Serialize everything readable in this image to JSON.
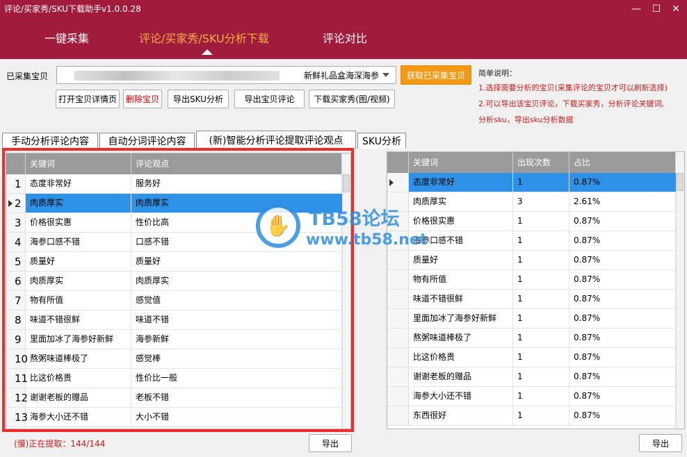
{
  "window": {
    "title": "评论/买家秀/SKU下载助手v1.0.0.28",
    "controls": [
      "—",
      "☐",
      "✕"
    ]
  },
  "nav": [
    {
      "label": "一键采集"
    },
    {
      "label": "评论/买家秀/SKU分析下载"
    },
    {
      "label": "评论对比"
    }
  ],
  "toolbar": {
    "collected_label": "已采集宝贝",
    "combo_value": "新鲜礼品盒海深海参",
    "fetch_button": "获取已采集宝贝",
    "buttons": [
      "打开宝贝详情页",
      "删除宝贝",
      "导出SKU分析",
      "导出宝贝评论",
      "下载买家秀(图/视频)"
    ]
  },
  "description": {
    "title": "简单说明：",
    "lines": [
      "1.选择需要分析的宝贝(采集评论的宝贝才可以刷新选择)",
      "2.可以导出该宝贝评论，下载买家秀，分析评论关键词,",
      "分析sku，导出sku分析数据"
    ]
  },
  "tabs": [
    "手动分析评论内容",
    "自动分词评论内容",
    "(新)智能分析评论提取评论观点",
    "SKU分析"
  ],
  "left_grid": {
    "headers": [
      "关键词",
      "评论观点"
    ],
    "rows": [
      {
        "num": "1",
        "keyword": "态度非常好",
        "opinion": "服务好"
      },
      {
        "num": "2",
        "keyword": "肉质厚实",
        "opinion": "肉质厚实"
      },
      {
        "num": "3",
        "keyword": "价格很实惠",
        "opinion": "性价比高"
      },
      {
        "num": "4",
        "keyword": "海参口感不错",
        "opinion": "口感不错"
      },
      {
        "num": "5",
        "keyword": "质量好",
        "opinion": "质量好"
      },
      {
        "num": "6",
        "keyword": "肉质厚实",
        "opinion": "肉质厚实"
      },
      {
        "num": "7",
        "keyword": "物有所值",
        "opinion": "感觉值"
      },
      {
        "num": "8",
        "keyword": "味道不错很鲜",
        "opinion": "味道不错"
      },
      {
        "num": "9",
        "keyword": "里面加冰了海参好新鲜",
        "opinion": "海参新鲜"
      },
      {
        "num": "10",
        "keyword": "熬粥味道棒极了",
        "opinion": "感觉棒"
      },
      {
        "num": "11",
        "keyword": "比这价格贵",
        "opinion": "性价比一般"
      },
      {
        "num": "12",
        "keyword": "谢谢老板的赠品",
        "opinion": "老板不错"
      },
      {
        "num": "13",
        "keyword": "海参大小还不错",
        "opinion": "大小不错"
      }
    ]
  },
  "right_grid": {
    "headers": [
      "关键词",
      "出现次数",
      "占比"
    ],
    "rows": [
      {
        "keyword": "态度非常好",
        "count": "1",
        "ratio": "0.87%"
      },
      {
        "keyword": "肉质厚实",
        "count": "3",
        "ratio": "2.61%"
      },
      {
        "keyword": "价格很实惠",
        "count": "1",
        "ratio": "0.87%"
      },
      {
        "keyword": "海参口感不错",
        "count": "1",
        "ratio": "0.87%"
      },
      {
        "keyword": "质量好",
        "count": "1",
        "ratio": "0.87%"
      },
      {
        "keyword": "物有所值",
        "count": "1",
        "ratio": "0.87%"
      },
      {
        "keyword": "味道不错很鲜",
        "count": "1",
        "ratio": "0.87%"
      },
      {
        "keyword": "里面加冰了海参好新鲜",
        "count": "1",
        "ratio": "0.87%"
      },
      {
        "keyword": "熬粥味道棒极了",
        "count": "1",
        "ratio": "0.87%"
      },
      {
        "keyword": "比这价格贵",
        "count": "1",
        "ratio": "0.87%"
      },
      {
        "keyword": "谢谢老板的赠品",
        "count": "1",
        "ratio": "0.87%"
      },
      {
        "keyword": "海参大小还不错",
        "count": "1",
        "ratio": "0.87%"
      },
      {
        "keyword": "东西很好",
        "count": "1",
        "ratio": "0.87%"
      }
    ]
  },
  "status": "(慢)正在提取：144/144",
  "export_label": "导出",
  "watermark": {
    "line1": "TB58论坛",
    "line2": "www.tb58.net"
  },
  "colors": {
    "header": "#a11b3d",
    "nav_active": "#f3b13f",
    "selection": "#2e93e8",
    "highlight_box": "#ee2e2e",
    "fetch_button": "#f29a16"
  }
}
